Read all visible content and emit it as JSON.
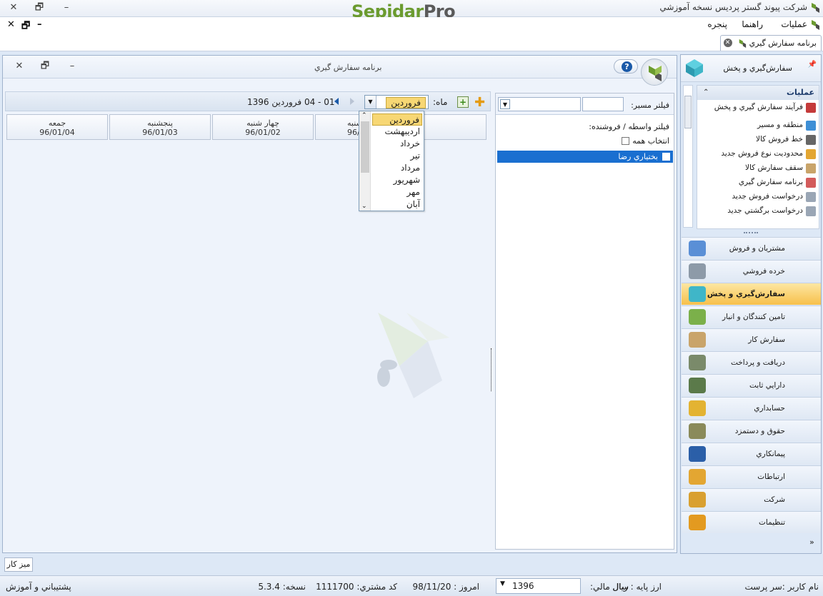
{
  "app": {
    "title": "شرکت پیوند گستر پردیس نسخه آموزشي",
    "brand_a": "Sepidar",
    "brand_b": "Pro"
  },
  "menu": {
    "items": [
      "عملیات",
      "راهنما",
      "پنجره"
    ]
  },
  "doc_tab": {
    "label": "برنامه سفارش گيري"
  },
  "child": {
    "title": "برنامه سفارش گيري",
    "help": "?"
  },
  "calendar": {
    "period": "01 - 04 فروردين 1396",
    "month_label": "ماه:",
    "month_value": "فروردين",
    "days": [
      {
        "name": "جمعه",
        "date": "96/01/04"
      },
      {
        "name": "پنجشنبه",
        "date": "96/01/03"
      },
      {
        "name": "چهار شنبه",
        "date": "96/01/02"
      },
      {
        "name": "سه شنبه",
        "date": "96/01/01"
      }
    ],
    "months": [
      "فروردين",
      "ارديبهشت",
      "خرداد",
      "تير",
      "مرداد",
      "شهريور",
      "مهر",
      "آبان"
    ]
  },
  "filter": {
    "route_label": "فيلتر مسير:",
    "agent_label": "فيلتر واسطه / فروشنده:",
    "select_all": "انتخاب همه",
    "agents": [
      "بختياري رضا"
    ]
  },
  "sidebar": {
    "title": "سفارش‌گيري و پخش",
    "ops_title": "عمليات",
    "ops": [
      {
        "label": "فرآيند سفارش گيري و پخش",
        "color": "#c43a3a"
      },
      {
        "label": "منطقه و مسير",
        "color": "#3e8fd6"
      },
      {
        "label": "خط فروش کالا",
        "color": "#666666"
      },
      {
        "label": "محدوديت نوع فروش جديد",
        "color": "#e3a632"
      },
      {
        "label": "سقف سفارش کالا",
        "color": "#c9a46a"
      },
      {
        "label": "برنامه سفارش گيري",
        "color": "#d35b5b"
      },
      {
        "label": "درخواست فروش جديد",
        "color": "#9aa6b5"
      },
      {
        "label": "درخواست برگشتي جديد",
        "color": "#9aa6b5"
      }
    ],
    "nav": [
      {
        "label": "مشتريان و فروش",
        "color": "#5a8fd6",
        "active": false
      },
      {
        "label": "خرده فروشي",
        "color": "#8d9aa8",
        "active": false
      },
      {
        "label": "سفارش‌گيري و پخش",
        "color": "#3fb6c8",
        "active": true
      },
      {
        "label": "تامين کنندگان و انبار",
        "color": "#7bb04a",
        "active": false
      },
      {
        "label": "سفارش کار",
        "color": "#c9a46a",
        "active": false
      },
      {
        "label": "دريافت و پرداخت",
        "color": "#7a8a6a",
        "active": false
      },
      {
        "label": "دارايي ثابت",
        "color": "#5b7a4a",
        "active": false
      },
      {
        "label": "حسابداري",
        "color": "#e3b332",
        "active": false
      },
      {
        "label": "حقوق و دستمزد",
        "color": "#8a8a5a",
        "active": false
      },
      {
        "label": "پيمانکاري",
        "color": "#2b5fa8",
        "active": false
      },
      {
        "label": "ارتباطات",
        "color": "#e3a632",
        "active": false
      },
      {
        "label": "شرکت",
        "color": "#d9a030",
        "active": false
      },
      {
        "label": "تنظيمات",
        "color": "#e39a20",
        "active": false
      }
    ]
  },
  "desk_tab": "ميز کار",
  "status": {
    "user": "نام کاربر :سر پرست",
    "currency": "ارز پايه : ريال",
    "fiscal_label": "سال مالي:",
    "fiscal_year": "1396",
    "today": "امروز : 98/11/20",
    "customer_code": "کد مشتري: 1111700",
    "version": "نسخه: 5.3.4",
    "support": "پشتيباني و آموزش"
  }
}
